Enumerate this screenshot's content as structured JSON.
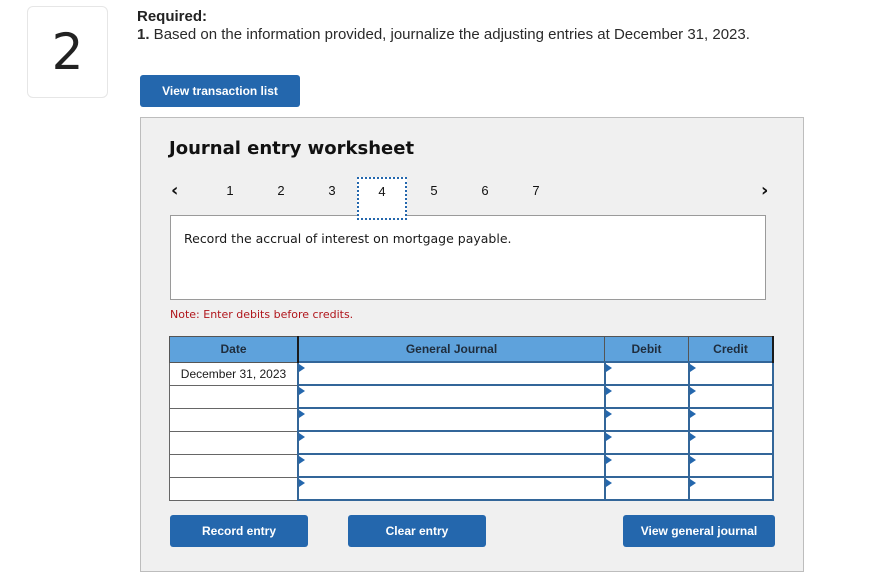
{
  "question": {
    "number": "2",
    "required_label": "Required:",
    "instruction_num": "1.",
    "instruction_text": " Based on the information provided, journalize the adjusting entries at December 31, 2023."
  },
  "buttons": {
    "view_transaction_list": "View transaction list",
    "record_entry": "Record entry",
    "clear_entry": "Clear entry",
    "view_general_journal": "View general journal"
  },
  "worksheet": {
    "title": "Journal entry worksheet",
    "nav": {
      "prev_icon": "‹",
      "next_icon": "›",
      "pages": [
        "1",
        "2",
        "3",
        "4",
        "5",
        "6",
        "7"
      ],
      "active_page": "4"
    },
    "description": "Record the accrual of interest on mortgage payable.",
    "note": "Note: Enter debits before credits."
  },
  "journal_table": {
    "headers": {
      "date": "Date",
      "general_journal": "General Journal",
      "debit": "Debit",
      "credit": "Credit"
    },
    "rows": [
      {
        "date": "December 31, 2023",
        "account": "",
        "debit": "",
        "credit": ""
      },
      {
        "date": "",
        "account": "",
        "debit": "",
        "credit": ""
      },
      {
        "date": "",
        "account": "",
        "debit": "",
        "credit": ""
      },
      {
        "date": "",
        "account": "",
        "debit": "",
        "credit": ""
      },
      {
        "date": "",
        "account": "",
        "debit": "",
        "credit": ""
      },
      {
        "date": "",
        "account": "",
        "debit": "",
        "credit": ""
      }
    ]
  },
  "colors": {
    "button_blue": "#2467ad",
    "header_blue": "#5ea2dc",
    "note_red": "#b0151b",
    "panel_gray": "#f0f0f0"
  }
}
